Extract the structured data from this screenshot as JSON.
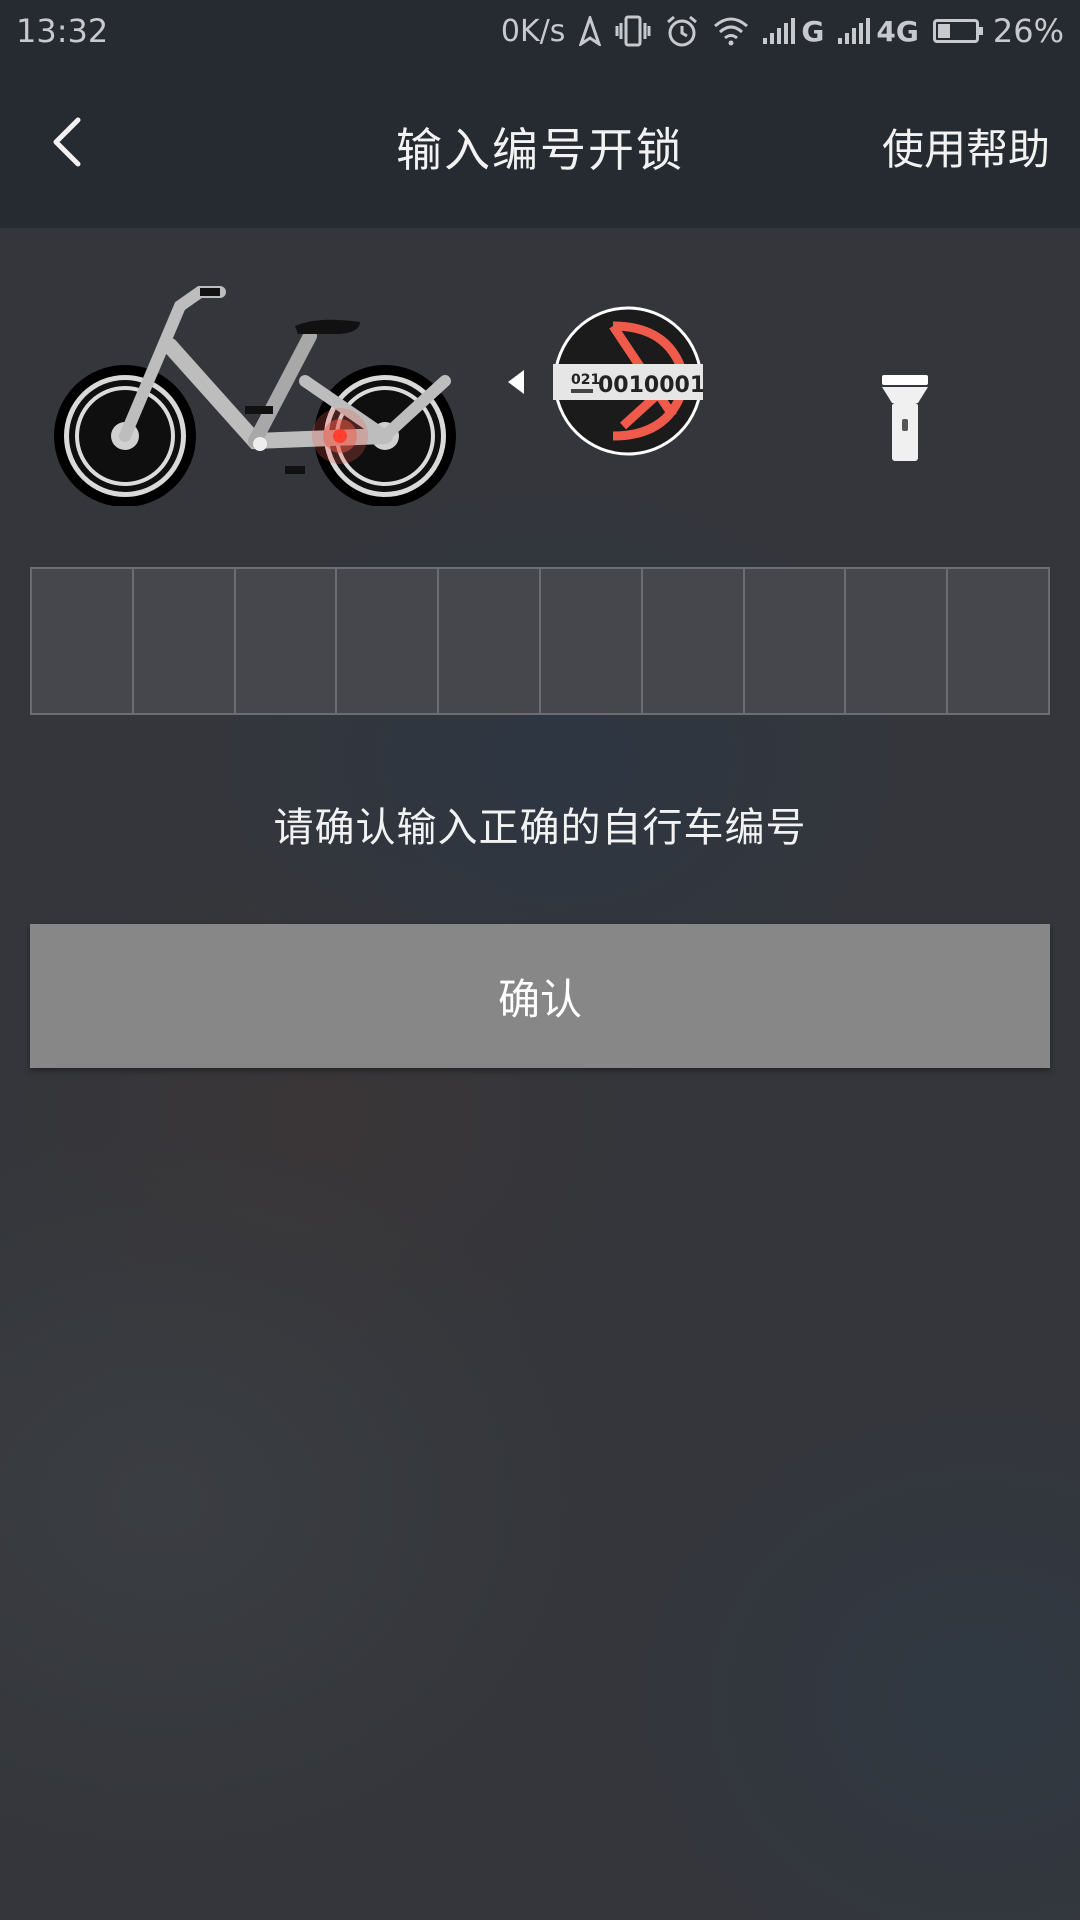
{
  "status_bar": {
    "time": "13:32",
    "net_speed": "0K/s",
    "network_g": "G",
    "network_4g": "4G",
    "battery_percent": "26%",
    "icons": [
      "location-icon",
      "vibrate-icon",
      "alarm-icon",
      "wifi-icon",
      "signal-icon",
      "signal-icon",
      "battery-icon"
    ]
  },
  "header": {
    "back_icon": "chevron-left-icon",
    "title": "输入编号开锁",
    "help_label": "使用帮助"
  },
  "illustration": {
    "plate_prefix": "021",
    "plate_number": "0010001",
    "accent_color": "#f05a4a"
  },
  "code_input": {
    "digit_count": 10,
    "digits": [
      "",
      "",
      "",
      "",
      "",
      "",
      "",
      "",
      "",
      ""
    ]
  },
  "hint": "请确认输入正确的自行车编号",
  "confirm_button": "确认"
}
